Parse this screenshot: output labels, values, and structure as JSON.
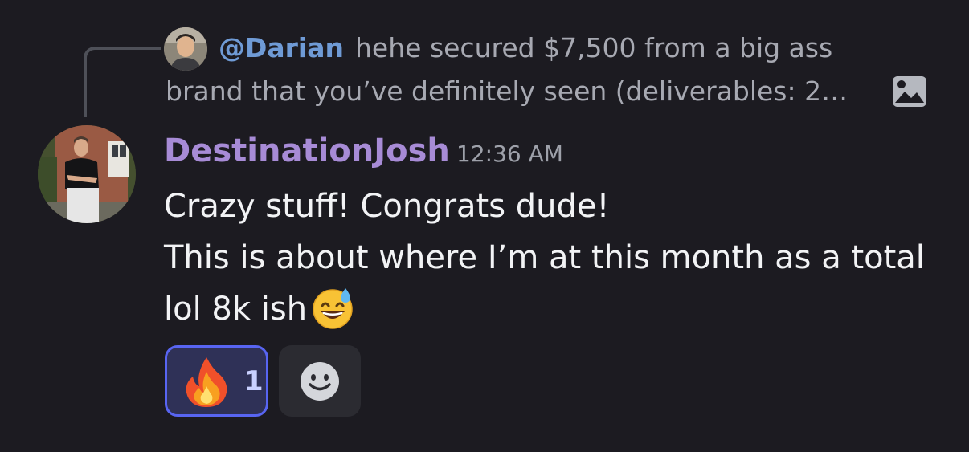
{
  "reply": {
    "mention": "@Darian",
    "text_line1": "hehe secured $7,500 from a big ass",
    "text_line2": "brand that you’ve definitely seen (deliverables: 2…",
    "attachment_icon": "image-icon"
  },
  "message": {
    "author": "DestinationJosh",
    "timestamp": "12:36 AM",
    "line1": "Crazy stuff! Congrats dude!",
    "line2": "This is about where I’m at this month as a total",
    "line3": "lol 8k ish",
    "inline_emoji": "grinning-face-with-sweat-emoji"
  },
  "reactions": [
    {
      "emoji": "fire-emoji",
      "count": "1",
      "active": true
    }
  ],
  "add_reaction_icon": "smiley-add-reaction-icon",
  "colors": {
    "background": "#1c1b21",
    "mention": "#6f9bd6",
    "author": "#a78bd6",
    "reaction_border": "#5865f2",
    "reaction_bg": "#2f3157"
  }
}
